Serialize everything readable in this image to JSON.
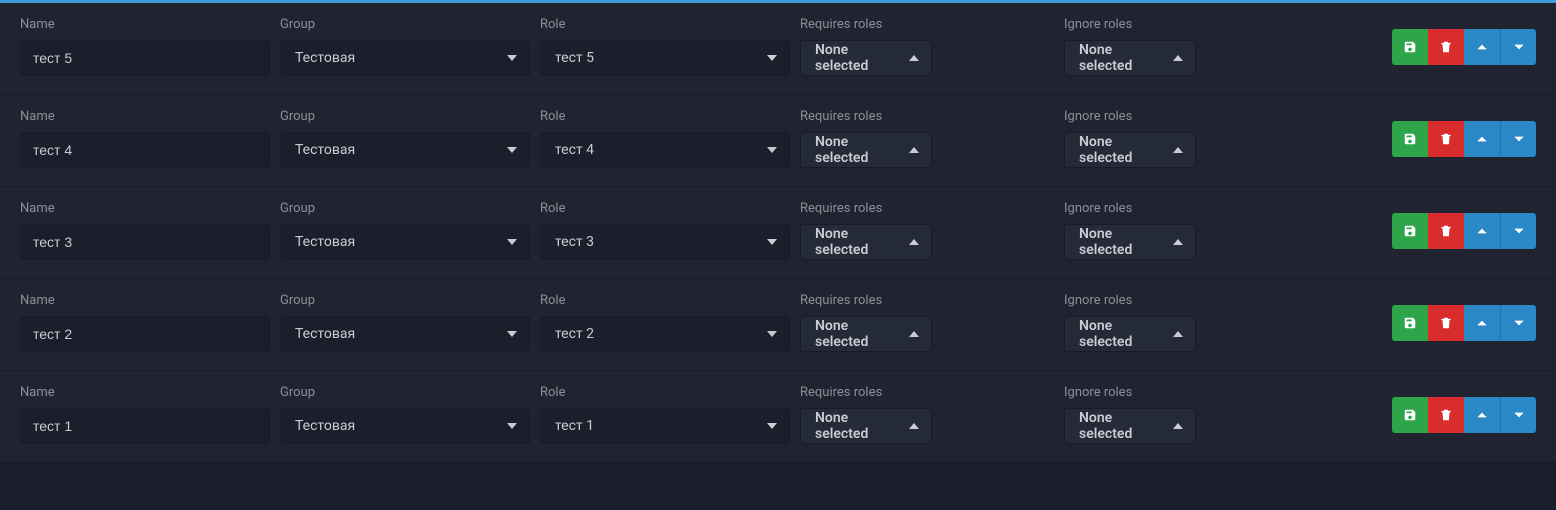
{
  "labels": {
    "name": "Name",
    "group": "Group",
    "role": "Role",
    "requires": "Requires roles",
    "ignore": "Ignore roles"
  },
  "none_selected": "None selected",
  "rows": [
    {
      "name": "тест 5",
      "group": "Тестовая",
      "role": "тест 5",
      "requires": "None selected",
      "ignore": "None selected"
    },
    {
      "name": "тест 4",
      "group": "Тестовая",
      "role": "тест 4",
      "requires": "None selected",
      "ignore": "None selected"
    },
    {
      "name": "тест 3",
      "group": "Тестовая",
      "role": "тест 3",
      "requires": "None selected",
      "ignore": "None selected"
    },
    {
      "name": "тест 2",
      "group": "Тестовая",
      "role": "тест 2",
      "requires": "None selected",
      "ignore": "None selected"
    },
    {
      "name": "тест 1",
      "group": "Тестовая",
      "role": "тест 1",
      "requires": "None selected",
      "ignore": "None selected"
    }
  ]
}
